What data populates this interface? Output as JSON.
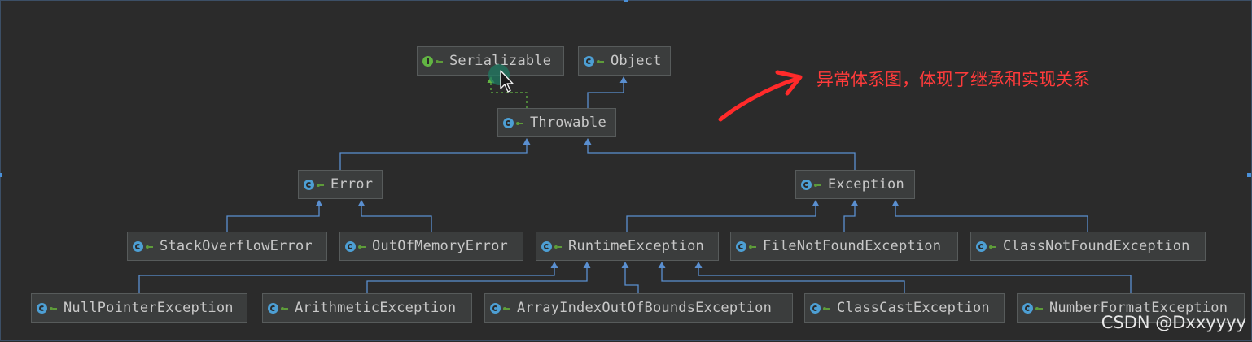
{
  "colors": {
    "background": "#2b2b2b",
    "node_fill": "#3b3d3d",
    "edge_extends": "#5a8fd0",
    "edge_implements": "#62b543",
    "annotation": "#ff3b3b"
  },
  "icons": {
    "class": "class-icon",
    "interface": "interface-icon",
    "visibility": "public-visibility-icon"
  },
  "diagram": {
    "nodes": [
      {
        "id": "serializable",
        "label": "Serializable",
        "kind": "interface"
      },
      {
        "id": "object",
        "label": "Object",
        "kind": "class"
      },
      {
        "id": "throwable",
        "label": "Throwable",
        "kind": "class"
      },
      {
        "id": "error",
        "label": "Error",
        "kind": "class"
      },
      {
        "id": "exception",
        "label": "Exception",
        "kind": "class"
      },
      {
        "id": "stackoverflowerror",
        "label": "StackOverflowError",
        "kind": "class"
      },
      {
        "id": "outofmemoryerror",
        "label": "OutOfMemoryError",
        "kind": "class"
      },
      {
        "id": "runtimeexception",
        "label": "RuntimeException",
        "kind": "class"
      },
      {
        "id": "filenotfoundexception",
        "label": "FileNotFoundException",
        "kind": "class"
      },
      {
        "id": "classnotfoundexception",
        "label": "ClassNotFoundException",
        "kind": "class"
      },
      {
        "id": "nullpointerexception",
        "label": "NullPointerException",
        "kind": "class"
      },
      {
        "id": "arithmeticexception",
        "label": "ArithmeticException",
        "kind": "class"
      },
      {
        "id": "arrayindexoutofboundsexception",
        "label": "ArrayIndexOutOfBoundsException",
        "kind": "class"
      },
      {
        "id": "classcastexception",
        "label": "ClassCastException",
        "kind": "class"
      },
      {
        "id": "numberformatexception",
        "label": "NumberFormatException",
        "kind": "class"
      }
    ],
    "edges": [
      {
        "from": "throwable",
        "to": "serializable",
        "type": "implements"
      },
      {
        "from": "throwable",
        "to": "object",
        "type": "extends"
      },
      {
        "from": "error",
        "to": "throwable",
        "type": "extends"
      },
      {
        "from": "exception",
        "to": "throwable",
        "type": "extends"
      },
      {
        "from": "stackoverflowerror",
        "to": "error",
        "type": "extends"
      },
      {
        "from": "outofmemoryerror",
        "to": "error",
        "type": "extends"
      },
      {
        "from": "runtimeexception",
        "to": "exception",
        "type": "extends"
      },
      {
        "from": "filenotfoundexception",
        "to": "exception",
        "type": "extends"
      },
      {
        "from": "classnotfoundexception",
        "to": "exception",
        "type": "extends"
      },
      {
        "from": "nullpointerexception",
        "to": "runtimeexception",
        "type": "extends"
      },
      {
        "from": "arithmeticexception",
        "to": "runtimeexception",
        "type": "extends"
      },
      {
        "from": "arrayindexoutofboundsexception",
        "to": "runtimeexception",
        "type": "extends"
      },
      {
        "from": "classcastexception",
        "to": "runtimeexception",
        "type": "extends"
      },
      {
        "from": "numberformatexception",
        "to": "runtimeexception",
        "type": "extends"
      }
    ]
  },
  "annotation": {
    "text": "异常体系图，体现了继承和实现关系"
  },
  "watermark": {
    "text": "CSDN @Dxxyyyy"
  }
}
